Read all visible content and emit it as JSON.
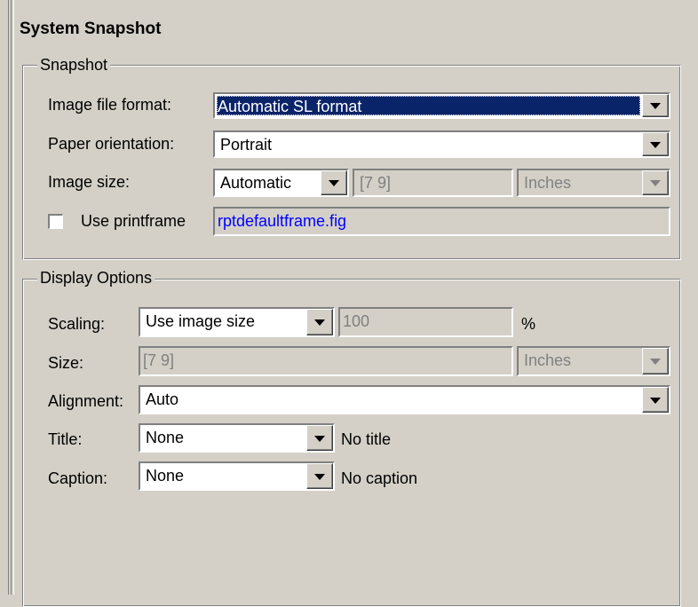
{
  "panel": {
    "title": "System Snapshot"
  },
  "snapshot": {
    "legend": "Snapshot",
    "image_format_label": "Image file format:",
    "image_format_value": "Automatic SL format",
    "paper_orientation_label": "Paper orientation:",
    "paper_orientation_value": "Portrait",
    "image_size_label": "Image size:",
    "image_size_mode": "Automatic",
    "image_size_value": "[7 9]",
    "image_size_units": "Inches",
    "use_printframe_label": "Use printframe",
    "use_printframe_checked": false,
    "printframe_file": "rptdefaultframe.fig"
  },
  "display": {
    "legend": "Display Options",
    "scaling_label": "Scaling:",
    "scaling_mode": "Use image size",
    "scaling_value": "100",
    "scaling_unit": "%",
    "size_label": "Size:",
    "size_value": "[7 9]",
    "size_units": "Inches",
    "alignment_label": "Alignment:",
    "alignment_value": "Auto",
    "title_label": "Title:",
    "title_value": "None",
    "title_desc": "No title",
    "caption_label": "Caption:",
    "caption_value": "None",
    "caption_desc": "No caption"
  },
  "colors": {
    "background": "#d4d0c8",
    "selection": "#0a246a",
    "link": "#0000ff"
  }
}
